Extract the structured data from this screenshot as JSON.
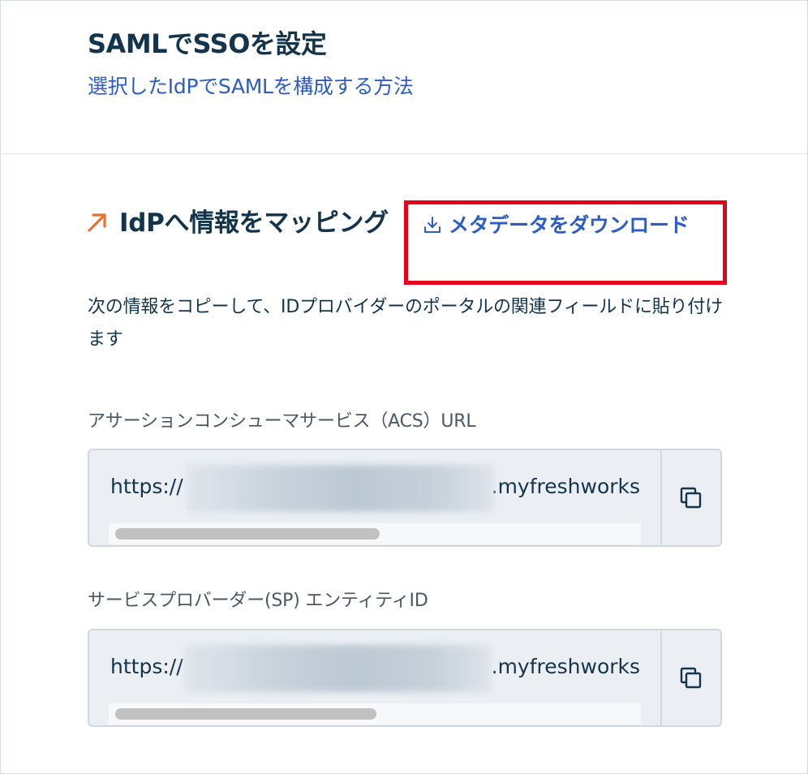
{
  "header": {
    "title": "SAMLでSSOを設定",
    "howto_link": "選択したIdPでSAMLを構成する方法"
  },
  "mapping": {
    "heading": "IdPへ情報をマッピング",
    "download_label": "メタデータをダウンロード",
    "description": "次の情報をコピーして、IDプロバイダーのポータルの関連フィールドに貼り付けます"
  },
  "fields": [
    {
      "label": "アサーションコンシューマサービス（ACS）URL",
      "value_prefix": "https://",
      "value_suffix": ".myfreshworks",
      "scroll_fraction": 0.5
    },
    {
      "label": "サービスプロバーダー(SP) エンティティID",
      "value_prefix": "https://",
      "value_suffix": ".myfreshworks",
      "scroll_fraction": 0.5
    }
  ],
  "icons": {
    "mapping": "arrow-up-right-icon",
    "download": "download-icon",
    "copy": "copy-icon"
  },
  "colors": {
    "link": "#2c5cc5",
    "heading": "#12344d",
    "accent_arrow": "#e8722c",
    "highlight_box": "#e5001b"
  }
}
